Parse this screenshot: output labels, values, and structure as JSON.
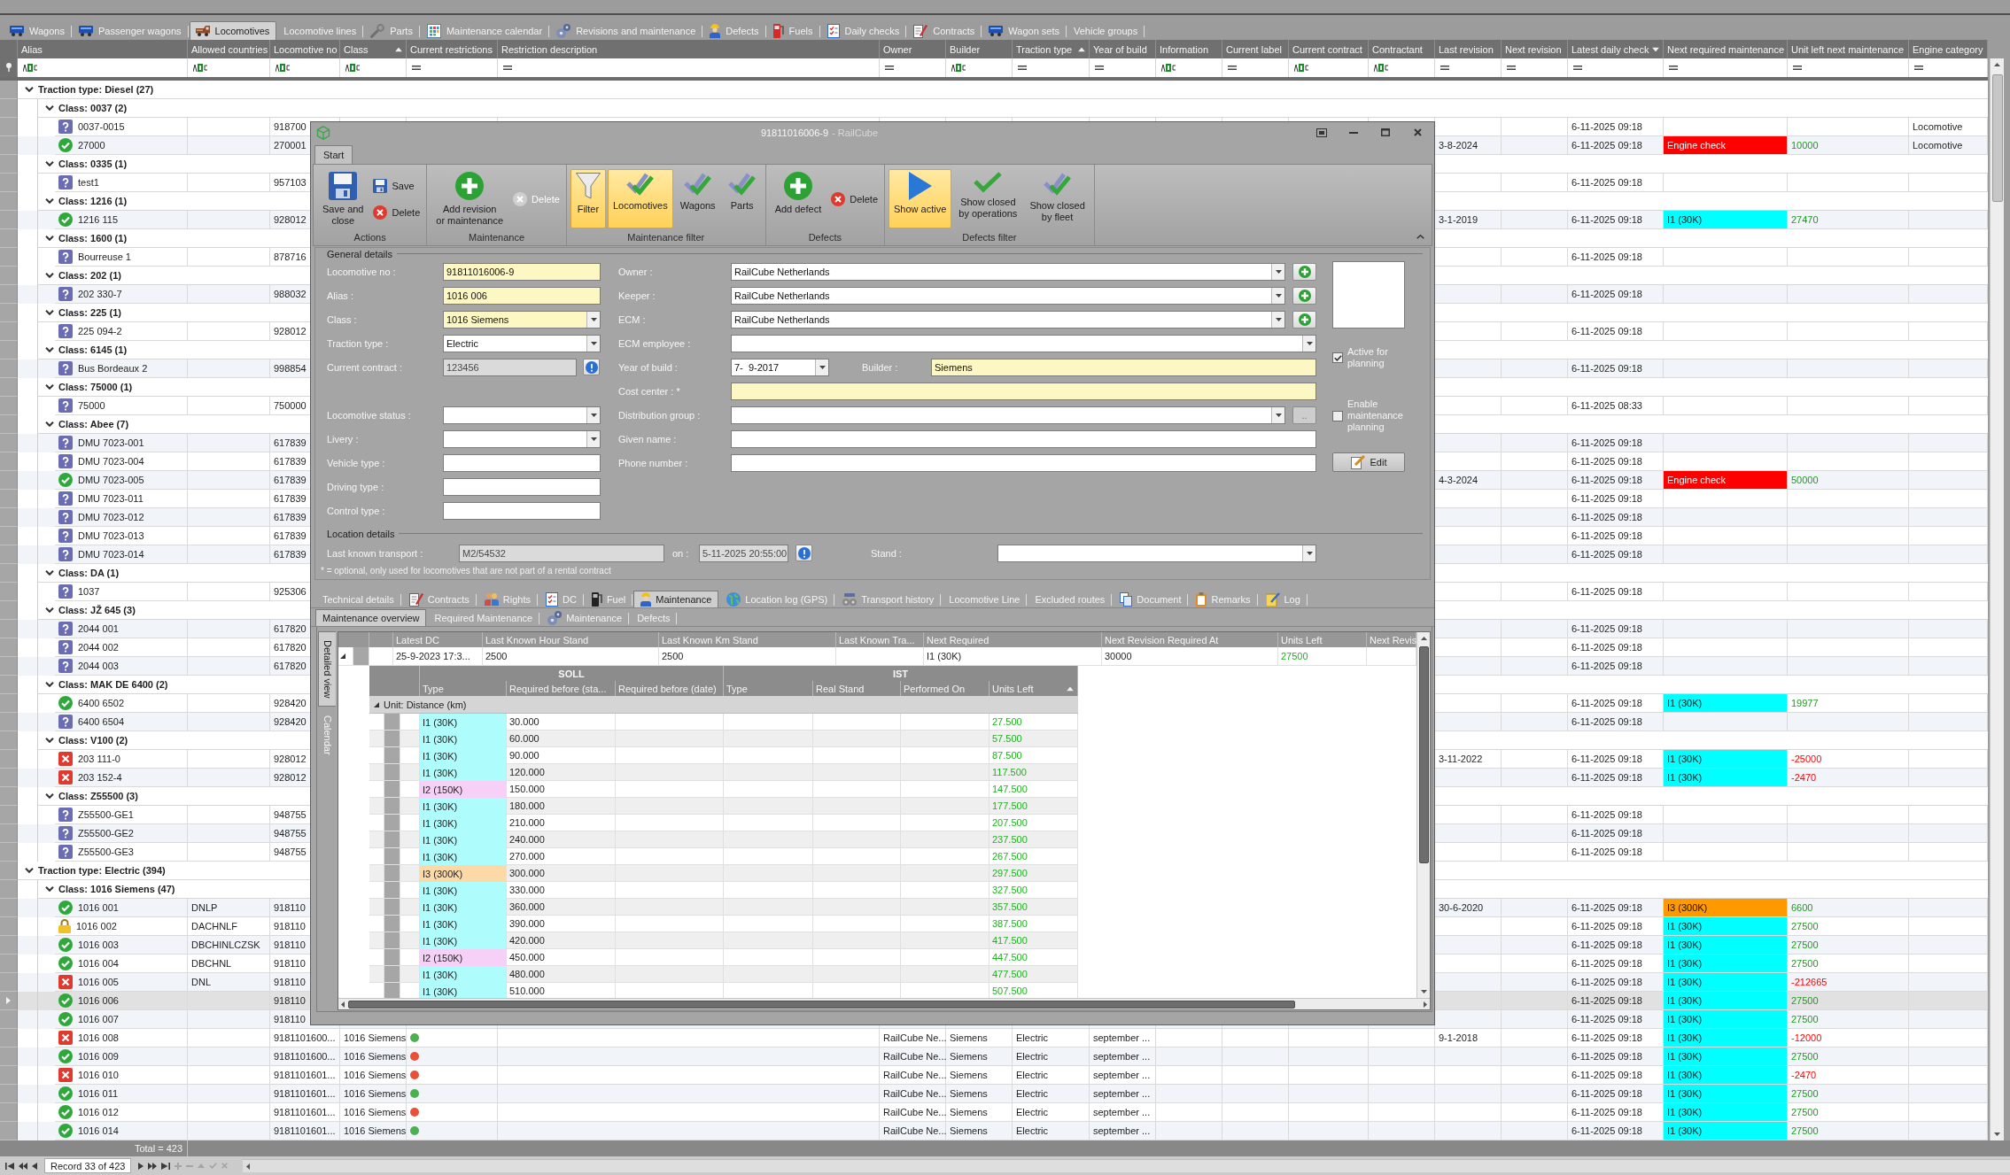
{
  "app_tabs": [
    {
      "label": "Wagons",
      "selected": false
    },
    {
      "label": "Passenger wagons",
      "selected": false
    },
    {
      "label": "Locomotives",
      "selected": true
    },
    {
      "label": "Locomotive lines",
      "selected": false
    },
    {
      "label": "Parts",
      "selected": false
    },
    {
      "label": "Maintenance calendar",
      "selected": false
    },
    {
      "label": "Revisions and maintenance",
      "selected": false
    },
    {
      "label": "Defects",
      "selected": false
    },
    {
      "label": "Fuels",
      "selected": false
    },
    {
      "label": "Daily checks",
      "selected": false
    },
    {
      "label": "Contracts",
      "selected": false
    },
    {
      "label": "Wagon sets",
      "selected": false
    },
    {
      "label": "Vehicle groups",
      "selected": false
    }
  ],
  "grid": {
    "columns": [
      {
        "label": "Alias",
        "sorted": false,
        "kind": "text"
      },
      {
        "label": "Allowed countries",
        "sorted": false,
        "kind": "text"
      },
      {
        "label": "Locomotive no",
        "sorted": false,
        "kind": "text"
      },
      {
        "label": "Class",
        "sorted": true,
        "descending": false,
        "kind": "text"
      },
      {
        "label": "Current restrictions",
        "sorted": false,
        "kind": "equals"
      },
      {
        "label": "Restriction description",
        "sorted": false,
        "kind": "equals"
      },
      {
        "label": "Owner",
        "sorted": false,
        "kind": "equals"
      },
      {
        "label": "Builder",
        "sorted": false,
        "kind": "text"
      },
      {
        "label": "Traction type",
        "sorted": true,
        "descending": false,
        "kind": "equals"
      },
      {
        "label": "Year of build",
        "sorted": false,
        "kind": "equals"
      },
      {
        "label": "Information",
        "sorted": false,
        "kind": "text"
      },
      {
        "label": "Current label",
        "sorted": false,
        "kind": "equals"
      },
      {
        "label": "Current contract",
        "sorted": false,
        "kind": "text"
      },
      {
        "label": "Contractant",
        "sorted": false,
        "kind": "text"
      },
      {
        "label": "Last revision",
        "sorted": false,
        "kind": "equals"
      },
      {
        "label": "Next revision",
        "sorted": false,
        "kind": "equals"
      },
      {
        "label": "Latest daily check",
        "sorted": true,
        "descending": true,
        "kind": "equals"
      },
      {
        "label": "Next required maintenance",
        "sorted": false,
        "kind": "equals"
      },
      {
        "label": "Unit left next maintenance",
        "sorted": false,
        "kind": "equals"
      },
      {
        "label": "Engine category",
        "sorted": false,
        "kind": "equals"
      }
    ],
    "groups": [
      {
        "label": "Traction type: Diesel (27)",
        "expanded": true,
        "children": [
          {
            "label": "Class: 0037 (2)",
            "expanded": true,
            "children": [
              {
                "kind": "unknown",
                "selected": false,
                "alias": "0037-0015",
                "locomotive_no": "918700",
                "latest_daily_check": "6-11-2025 09:18",
                "engine_category": "Locomotive"
              },
              {
                "kind": "ok",
                "selected": false,
                "alias": "27000",
                "locomotive_no": "270001",
                "last_revision": "3-8-2024",
                "latest_daily_check": "6-11-2025 09:18",
                "next_required_maintenance": {
                  "label": "Engine check",
                  "color": "#ff0000"
                },
                "unit_left": {
                  "value": "10000",
                  "overdue": false
                },
                "engine_category": "Locomotive"
              }
            ]
          },
          {
            "label": "Class: 0335 (1)",
            "expanded": true,
            "children": [
              {
                "kind": "unknown",
                "selected": false,
                "alias": "test1",
                "locomotive_no": "957103",
                "latest_daily_check": "6-11-2025 09:18"
              }
            ]
          },
          {
            "label": "Class: 1216 (1)",
            "expanded": true,
            "children": [
              {
                "kind": "ok",
                "selected": false,
                "alias": "1216 115",
                "locomotive_no": "928012",
                "last_revision": "3-1-2019",
                "latest_daily_check": "6-11-2025 09:18",
                "next_required_maintenance": {
                  "label": "I1 (30K)",
                  "color": "#00ffff"
                },
                "unit_left": {
                  "value": "27470",
                  "overdue": false
                }
              }
            ]
          },
          {
            "label": "Class: 1600 (1)",
            "expanded": true,
            "children": [
              {
                "kind": "unknown",
                "selected": false,
                "alias": "Bourreuse 1",
                "locomotive_no": "878716",
                "latest_daily_check": "6-11-2025 09:18"
              }
            ]
          },
          {
            "label": "Class: 202 (1)",
            "expanded": true,
            "children": [
              {
                "kind": "unknown",
                "selected": false,
                "alias": "202 330-7",
                "locomotive_no": "988032",
                "latest_daily_check": "6-11-2025 09:18"
              }
            ]
          },
          {
            "label": "Class: 225 (1)",
            "expanded": true,
            "children": [
              {
                "kind": "unknown",
                "selected": false,
                "alias": "225 094-2",
                "locomotive_no": "928012",
                "latest_daily_check": "6-11-2025 09:18"
              }
            ]
          },
          {
            "label": "Class: 6145 (1)",
            "expanded": true,
            "children": [
              {
                "kind": "unknown",
                "selected": false,
                "alias": "Bus Bordeaux 2",
                "locomotive_no": "998854",
                "latest_daily_check": "6-11-2025 09:18"
              }
            ]
          },
          {
            "label": "Class: 75000 (1)",
            "expanded": true,
            "children": [
              {
                "kind": "unknown",
                "selected": false,
                "alias": "75000",
                "locomotive_no": "750000",
                "latest_daily_check": "6-11-2025 08:33"
              }
            ]
          },
          {
            "label": "Class: Abee (7)",
            "expanded": true,
            "children": [
              {
                "kind": "unknown",
                "selected": false,
                "alias": "DMU 7023-001",
                "locomotive_no": "617839",
                "latest_daily_check": "6-11-2025 09:18"
              },
              {
                "kind": "unknown",
                "selected": false,
                "alias": "DMU 7023-004",
                "locomotive_no": "617839",
                "latest_daily_check": "6-11-2025 09:18"
              },
              {
                "kind": "ok",
                "selected": false,
                "alias": "DMU 7023-005",
                "locomotive_no": "617839",
                "last_revision": "4-3-2024",
                "latest_daily_check": "6-11-2025 09:18",
                "next_required_maintenance": {
                  "label": "Engine check",
                  "color": "#ff0000"
                },
                "unit_left": {
                  "value": "50000",
                  "overdue": false
                }
              },
              {
                "kind": "unknown",
                "selected": false,
                "alias": "DMU 7023-011",
                "locomotive_no": "617839",
                "latest_daily_check": "6-11-2025 09:18"
              },
              {
                "kind": "unknown",
                "selected": false,
                "alias": "DMU 7023-012",
                "locomotive_no": "617839",
                "latest_daily_check": "6-11-2025 09:18"
              },
              {
                "kind": "unknown",
                "selected": false,
                "alias": "DMU 7023-013",
                "locomotive_no": "617839",
                "latest_daily_check": "6-11-2025 09:18"
              },
              {
                "kind": "unknown",
                "selected": false,
                "alias": "DMU 7023-014",
                "locomotive_no": "617839",
                "latest_daily_check": "6-11-2025 09:18"
              }
            ]
          },
          {
            "label": "Class: DA (1)",
            "expanded": true,
            "children": [
              {
                "kind": "unknown",
                "selected": false,
                "alias": "1037",
                "locomotive_no": "925306",
                "latest_daily_check": "6-11-2025 09:18"
              }
            ]
          },
          {
            "label": "Class: JŽ 645 (3)",
            "expanded": true,
            "children": [
              {
                "kind": "unknown",
                "selected": false,
                "alias": "2044 001",
                "locomotive_no": "617820",
                "latest_daily_check": "6-11-2025 09:18"
              },
              {
                "kind": "unknown",
                "selected": false,
                "alias": "2044 002",
                "locomotive_no": "617820",
                "latest_daily_check": "6-11-2025 09:18"
              },
              {
                "kind": "unknown",
                "selected": false,
                "alias": "2044 003",
                "locomotive_no": "617820",
                "latest_daily_check": "6-11-2025 09:18"
              }
            ]
          },
          {
            "label": "Class: MAK DE 6400 (2)",
            "expanded": true,
            "children": [
              {
                "kind": "ok",
                "selected": false,
                "alias": "6400 6502",
                "locomotive_no": "928420",
                "latest_daily_check": "6-11-2025 09:18",
                "next_required_maintenance": {
                  "label": "I1 (30K)",
                  "color": "#00ffff"
                },
                "unit_left": {
                  "value": "19977",
                  "overdue": false
                }
              },
              {
                "kind": "unknown",
                "selected": false,
                "alias": "6400 6504",
                "locomotive_no": "928420",
                "latest_daily_check": "6-11-2025 09:18"
              }
            ]
          },
          {
            "label": "Class: V100 (2)",
            "expanded": true,
            "children": [
              {
                "kind": "error",
                "selected": false,
                "alias": "203 111-0",
                "locomotive_no": "928012",
                "last_revision": "3-11-2022",
                "latest_daily_check": "6-11-2025 09:18",
                "next_required_maintenance": {
                  "label": "I1 (30K)",
                  "color": "#00ffff"
                },
                "unit_left": {
                  "value": "-25000",
                  "overdue": true
                }
              },
              {
                "kind": "error",
                "selected": false,
                "alias": "203 152-4",
                "locomotive_no": "928012",
                "latest_daily_check": "6-11-2025 09:18",
                "next_required_maintenance": {
                  "label": "I1 (30K)",
                  "color": "#00ffff"
                },
                "unit_left": {
                  "value": "-2470",
                  "overdue": true
                }
              }
            ]
          },
          {
            "label": "Class: Z55500 (3)",
            "expanded": true,
            "children": [
              {
                "kind": "unknown",
                "selected": false,
                "alias": "Z55500-GE1",
                "locomotive_no": "948755",
                "latest_daily_check": "6-11-2025 09:18"
              },
              {
                "kind": "unknown",
                "selected": false,
                "alias": "Z55500-GE2",
                "locomotive_no": "948755",
                "latest_daily_check": "6-11-2025 09:18"
              },
              {
                "kind": "unknown",
                "selected": false,
                "alias": "Z55500-GE3",
                "locomotive_no": "948755",
                "latest_daily_check": "6-11-2025 09:18"
              }
            ]
          }
        ]
      },
      {
        "label": "Traction type: Electric (394)",
        "expanded": true,
        "children": [
          {
            "label": "Class: 1016 Siemens (47)",
            "expanded": true,
            "children": [
              {
                "kind": "ok",
                "selected": false,
                "alias": "1016 001",
                "allowed_countries": "DNLP",
                "locomotive_no": "918110",
                "last_revision": "30-6-2020",
                "latest_daily_check": "6-11-2025 09:18",
                "next_required_maintenance": {
                  "label": "I3 (300K)",
                  "color": "#ff9900"
                },
                "unit_left": {
                  "value": "6600",
                  "overdue": false
                }
              },
              {
                "kind": "locked",
                "selected": false,
                "alias": "1016 002",
                "allowed_countries": "DACHNLF",
                "locomotive_no": "918110",
                "latest_daily_check": "6-11-2025 09:18",
                "next_required_maintenance": {
                  "label": "I1 (30K)",
                  "color": "#00ffff"
                },
                "unit_left": {
                  "value": "27500",
                  "overdue": false
                }
              },
              {
                "kind": "ok",
                "selected": false,
                "alias": "1016 003",
                "allowed_countries": "DBCHINLCZSK",
                "locomotive_no": "918110",
                "latest_daily_check": "6-11-2025 09:18",
                "next_required_maintenance": {
                  "label": "I1 (30K)",
                  "color": "#00ffff"
                },
                "unit_left": {
                  "value": "27500",
                  "overdue": false
                }
              },
              {
                "kind": "ok",
                "selected": false,
                "alias": "1016 004",
                "allowed_countries": "DBCHNL",
                "locomotive_no": "918110",
                "latest_daily_check": "6-11-2025 09:18",
                "next_required_maintenance": {
                  "label": "I1 (30K)",
                  "color": "#00ffff"
                },
                "unit_left": {
                  "value": "27500",
                  "overdue": false
                }
              },
              {
                "kind": "error",
                "selected": false,
                "alias": "1016 005",
                "allowed_countries": "DNL",
                "locomotive_no": "918110",
                "latest_daily_check": "6-11-2025 09:18",
                "next_required_maintenance": {
                  "label": "I1 (30K)",
                  "color": "#00ffff"
                },
                "unit_left": {
                  "value": "-212665",
                  "overdue": true
                }
              },
              {
                "kind": "ok",
                "selected": true,
                "alias": "1016 006",
                "locomotive_no": "918110",
                "latest_daily_check": "6-11-2025 09:18",
                "next_required_maintenance": {
                  "label": "I1 (30K)",
                  "color": "#00ffff"
                },
                "unit_left": {
                  "value": "27500",
                  "overdue": false
                }
              },
              {
                "kind": "ok",
                "selected": false,
                "alias": "1016 007",
                "locomotive_no": "918110",
                "latest_daily_check": "6-11-2025 09:18",
                "next_required_maintenance": {
                  "label": "I1 (30K)",
                  "color": "#00ffff"
                },
                "unit_left": {
                  "value": "27500",
                  "overdue": false
                }
              },
              {
                "kind": "error",
                "selected": false,
                "alias": "1016 008",
                "locomotive_no": "9181101600...",
                "class": "1016 Siemens",
                "current_restrictions": {
                  "color": "#4cb050"
                },
                "owner": "RailCube Ne...",
                "builder": "Siemens",
                "traction_type": "Electric",
                "year_of_build": "september ...",
                "last_revision": "9-1-2018",
                "latest_daily_check": "6-11-2025 09:18",
                "next_required_maintenance": {
                  "label": "I1 (30K)",
                  "color": "#00ffff"
                },
                "unit_left": {
                  "value": "-12000",
                  "overdue": true
                }
              },
              {
                "kind": "ok",
                "selected": false,
                "alias": "1016 009",
                "locomotive_no": "9181101600...",
                "class": "1016 Siemens",
                "current_restrictions": {
                  "color": "#e8503a"
                },
                "owner": "RailCube Ne...",
                "builder": "Siemens",
                "traction_type": "Electric",
                "year_of_build": "september ...",
                "latest_daily_check": "6-11-2025 09:18",
                "next_required_maintenance": {
                  "label": "I1 (30K)",
                  "color": "#00ffff"
                },
                "unit_left": {
                  "value": "27500",
                  "overdue": false
                }
              },
              {
                "kind": "error",
                "selected": false,
                "alias": "1016 010",
                "locomotive_no": "9181101601...",
                "class": "1016 Siemens",
                "current_restrictions": {
                  "color": "#e8503a"
                },
                "owner": "RailCube Ne...",
                "builder": "Siemens",
                "traction_type": "Electric",
                "year_of_build": "september ...",
                "latest_daily_check": "6-11-2025 09:18",
                "next_required_maintenance": {
                  "label": "I1 (30K)",
                  "color": "#00ffff"
                },
                "unit_left": {
                  "value": "-2470",
                  "overdue": true
                }
              },
              {
                "kind": "ok",
                "selected": false,
                "alias": "1016 011",
                "locomotive_no": "9181101601...",
                "class": "1016 Siemens",
                "current_restrictions": {
                  "color": "#4cb050"
                },
                "owner": "RailCube Ne...",
                "builder": "Siemens",
                "traction_type": "Electric",
                "year_of_build": "september ...",
                "latest_daily_check": "6-11-2025 09:18",
                "next_required_maintenance": {
                  "label": "I1 (30K)",
                  "color": "#00ffff"
                },
                "unit_left": {
                  "value": "27500",
                  "overdue": false
                }
              },
              {
                "kind": "ok",
                "selected": false,
                "alias": "1016 012",
                "locomotive_no": "9181101601...",
                "class": "1016 Siemens",
                "current_restrictions": {
                  "color": "#e8503a"
                },
                "owner": "RailCube Ne...",
                "builder": "Siemens",
                "traction_type": "Electric",
                "year_of_build": "september ...",
                "latest_daily_check": "6-11-2025 09:18",
                "next_required_maintenance": {
                  "label": "I1 (30K)",
                  "color": "#00ffff"
                },
                "unit_left": {
                  "value": "27500",
                  "overdue": false
                }
              },
              {
                "kind": "ok",
                "selected": false,
                "alias": "1016 014",
                "locomotive_no": "9181101601...",
                "class": "1016 Siemens",
                "current_restrictions": {
                  "color": "#4cb050"
                },
                "owner": "RailCube Ne...",
                "builder": "Siemens",
                "traction_type": "Electric",
                "year_of_build": "september ...",
                "latest_daily_check": "6-11-2025 09:18",
                "next_required_maintenance": {
                  "label": "I1 (30K)",
                  "color": "#00ffff"
                },
                "unit_left": {
                  "value": "27500",
                  "overdue": false
                }
              }
            ]
          }
        ]
      }
    ],
    "total": "Total = 423"
  },
  "navigator": {
    "record": "Record 33 of 423",
    "buttons": [
      {
        "kind": "first",
        "disabled": false
      },
      {
        "kind": "prev_page",
        "disabled": false
      },
      {
        "kind": "prev",
        "disabled": false
      },
      {
        "kind": "next",
        "disabled": false
      },
      {
        "kind": "next_page",
        "disabled": false
      },
      {
        "kind": "last",
        "disabled": false
      },
      {
        "kind": "append",
        "disabled": true
      },
      {
        "kind": "remove",
        "disabled": true
      },
      {
        "kind": "edit",
        "disabled": true
      },
      {
        "kind": "end_edit",
        "disabled": true
      },
      {
        "kind": "cancel_edit",
        "disabled": true
      }
    ]
  },
  "dialog": {
    "title": "91811016006-9",
    "app_name": "- RailCube",
    "ribbon": {
      "tabs": [
        {
          "label": "Start",
          "selected": true
        }
      ],
      "groups": [
        {
          "label": "Actions",
          "buttons": [
            {
              "kind": "large",
              "label": "Save and\nclose",
              "disabled": false
            },
            {
              "kind": "small",
              "label": "Save",
              "disabled": false
            },
            {
              "kind": "small",
              "label": "Delete",
              "disabled": false
            }
          ]
        },
        {
          "label": "Maintenance",
          "buttons": [
            {
              "kind": "large",
              "label": "Add revision\nor maintenance",
              "disabled": false
            },
            {
              "kind": "small",
              "label": "Delete",
              "disabled": true
            }
          ]
        },
        {
          "label": "Maintenance filter",
          "buttons": [
            {
              "kind": "large",
              "label": "Filter",
              "pressed": true,
              "disabled": false
            },
            {
              "kind": "large",
              "label": "Locomotives",
              "pressed": true,
              "disabled": false
            },
            {
              "kind": "large",
              "label": "Wagons",
              "pressed": false,
              "disabled": false
            },
            {
              "kind": "large",
              "label": "Parts",
              "pressed": false,
              "disabled": false
            }
          ]
        },
        {
          "label": "Defects",
          "buttons": [
            {
              "kind": "large",
              "label": "Add defect",
              "disabled": false
            },
            {
              "kind": "small",
              "label": "Delete",
              "disabled": false
            }
          ]
        },
        {
          "label": "Defects filter",
          "buttons": [
            {
              "kind": "large",
              "label": "Show active",
              "pressed": true,
              "disabled": false
            },
            {
              "kind": "large",
              "label": "Show closed\nby operations",
              "pressed": false,
              "disabled": false
            },
            {
              "kind": "large",
              "label": "Show closed\nby fleet",
              "pressed": false,
              "disabled": false
            }
          ]
        }
      ]
    },
    "general": {
      "title": "General details",
      "left_groups": [
        [
          {
            "label": "Locomotive no :",
            "kind": "text",
            "value": "91811016006-9",
            "required": true,
            "disabled": false
          },
          {
            "label": "Alias :",
            "kind": "text",
            "value": "1016 006",
            "required": true,
            "disabled": false
          },
          {
            "label": "Class :",
            "kind": "dropdown",
            "value": "1016 Siemens",
            "required": true,
            "disabled": false
          },
          {
            "label": "Traction type :",
            "kind": "dropdown",
            "value": "Electric",
            "required": false,
            "disabled": false
          },
          {
            "label": "Current contract :",
            "kind": "text",
            "value": "123456",
            "required": false,
            "disabled": true,
            "button": {
              "kind": "info",
              "disabled": false
            }
          }
        ],
        [
          {
            "label": "Locomotive status :",
            "kind": "dropdown",
            "required": false,
            "disabled": false
          },
          {
            "label": "Livery :",
            "kind": "dropdown",
            "required": false,
            "disabled": false
          },
          {
            "label": "Vehicle type :",
            "kind": "text",
            "required": false,
            "disabled": false
          },
          {
            "label": "Driving type :",
            "kind": "text",
            "required": false,
            "disabled": false
          },
          {
            "label": "Control type :",
            "kind": "text",
            "required": false,
            "disabled": false
          }
        ]
      ],
      "middle": [
        {
          "label": "Owner :",
          "kind": "dropdown",
          "value": "RailCube Netherlands",
          "required": false,
          "disabled": false,
          "button": {
            "kind": "add",
            "disabled": false
          }
        },
        {
          "label": "Keeper :",
          "kind": "dropdown",
          "value": "RailCube Netherlands",
          "required": false,
          "disabled": false,
          "button": {
            "kind": "add",
            "disabled": false
          }
        },
        {
          "label": "ECM :",
          "kind": "dropdown",
          "value": "RailCube Netherlands",
          "required": false,
          "disabled": false,
          "button": {
            "kind": "add",
            "disabled": false
          }
        },
        {
          "label": "ECM employee :",
          "kind": "dropdown",
          "required": false,
          "disabled": false
        },
        {
          "label": "Year of build :",
          "kind": "date",
          "value": "7-  9-2017",
          "required": false,
          "disabled": false,
          "pair": {
            "label": "Builder :",
            "kind": "text",
            "value": "Siemens",
            "required": true,
            "disabled": false
          }
        },
        {
          "label": "Cost center : *",
          "kind": "text",
          "required": true,
          "disabled": false
        },
        {
          "label": "Distribution group :",
          "kind": "dropdown",
          "required": false,
          "disabled": false,
          "button": {
            "kind": "more",
            "label": "..",
            "disabled": true
          }
        },
        {
          "label": "Given name :",
          "kind": "text",
          "required": false,
          "disabled": false
        },
        {
          "label": "Phone number :",
          "kind": "text",
          "required": false,
          "disabled": false
        }
      ],
      "checkboxes": [
        {
          "label": "Active for\nplanning",
          "checked": true
        },
        {
          "label": "Enable\nmaintenance\nplanning",
          "checked": false
        }
      ],
      "edit_button": "Edit"
    },
    "location": {
      "title": "Location details",
      "fields": [
        {
          "label": "Last known transport :",
          "kind": "text",
          "value": "M2/54532",
          "disabled": true
        },
        {
          "label": "on :",
          "kind": "text",
          "value": "5-11-2025 20:55:00",
          "disabled": true,
          "button": {
            "kind": "info",
            "disabled": false
          }
        },
        {
          "label": "Stand :",
          "kind": "dropdown",
          "disabled": false
        }
      ],
      "note": "* = optional, only used for locomotives that are not part of a rental contract"
    },
    "tabs": [
      {
        "label": "Technical details",
        "selected": false
      },
      {
        "label": "Contracts",
        "selected": false
      },
      {
        "label": "Rights",
        "selected": false
      },
      {
        "label": "DC",
        "selected": false
      },
      {
        "label": "Fuel",
        "selected": false
      },
      {
        "label": "Maintenance",
        "selected": true
      },
      {
        "label": "Location log (GPS)",
        "selected": false
      },
      {
        "label": "Transport history",
        "selected": false
      },
      {
        "label": "Locomotive Line",
        "selected": false
      },
      {
        "label": "Excluded routes",
        "selected": false
      },
      {
        "label": "Document",
        "selected": false
      },
      {
        "label": "Remarks",
        "selected": false
      },
      {
        "label": "Log",
        "selected": false
      }
    ],
    "subtabs": [
      {
        "label": "Maintenance overview",
        "selected": true
      },
      {
        "label": "Required Maintenance",
        "selected": false
      },
      {
        "label": "Maintenance",
        "selected": false
      },
      {
        "label": "Defects",
        "selected": false
      }
    ],
    "side_tabs": [
      {
        "label": "Detailed view",
        "selected": true
      },
      {
        "label": "Calendar",
        "selected": false
      }
    ],
    "overview": {
      "columns": [
        "Latest DC",
        "Last Known Hour Stand",
        "Last Known Km Stand",
        "Last Known Tra...",
        "Next Required",
        "Next Revision Required At",
        "Units Left",
        "Next Revis"
      ],
      "rows": [
        {
          "expanded": true,
          "latest_dc": "25-9-2023 17:3...",
          "hour_stand": "2500",
          "km_stand": "2500",
          "next_required": "I1 (30K)",
          "next_revision_at": "30000",
          "units_left": "27500"
        }
      ]
    },
    "plan": {
      "bands": [
        "SOLL",
        "IST"
      ],
      "columns": [
        {
          "label": "Type",
          "sorted": false
        },
        {
          "label": "Required before (sta...",
          "sorted": false
        },
        {
          "label": "Required before (date)",
          "sorted": false
        },
        {
          "label": "Type",
          "sorted": false
        },
        {
          "label": "Real Stand",
          "sorted": false
        },
        {
          "label": "Performed On",
          "sorted": false
        },
        {
          "label": "Units Left",
          "sorted": true,
          "descending": false
        }
      ],
      "group": {
        "label": "Unit: Distance (km)",
        "expanded": true
      },
      "rows": [
        {
          "type": "I1 (30K)",
          "color": "#aefcfc",
          "required_before": "30.000",
          "units_left": "27.500"
        },
        {
          "type": "I1 (30K)",
          "color": "#aefcfc",
          "required_before": "60.000",
          "units_left": "57.500"
        },
        {
          "type": "I1 (30K)",
          "color": "#aefcfc",
          "required_before": "90.000",
          "units_left": "87.500"
        },
        {
          "type": "I1 (30K)",
          "color": "#aefcfc",
          "required_before": "120.000",
          "units_left": "117.500"
        },
        {
          "type": "I2 (150K)",
          "color": "#f6d0f6",
          "required_before": "150.000",
          "units_left": "147.500"
        },
        {
          "type": "I1 (30K)",
          "color": "#aefcfc",
          "required_before": "180.000",
          "units_left": "177.500"
        },
        {
          "type": "I1 (30K)",
          "color": "#aefcfc",
          "required_before": "210.000",
          "units_left": "207.500"
        },
        {
          "type": "I1 (30K)",
          "color": "#aefcfc",
          "required_before": "240.000",
          "units_left": "237.500"
        },
        {
          "type": "I1 (30K)",
          "color": "#aefcfc",
          "required_before": "270.000",
          "units_left": "267.500"
        },
        {
          "type": "I3 (300K)",
          "color": "#fdd9a8",
          "required_before": "300.000",
          "units_left": "297.500"
        },
        {
          "type": "I1 (30K)",
          "color": "#aefcfc",
          "required_before": "330.000",
          "units_left": "327.500"
        },
        {
          "type": "I1 (30K)",
          "color": "#aefcfc",
          "required_before": "360.000",
          "units_left": "357.500"
        },
        {
          "type": "I1 (30K)",
          "color": "#aefcfc",
          "required_before": "390.000",
          "units_left": "387.500"
        },
        {
          "type": "I1 (30K)",
          "color": "#aefcfc",
          "required_before": "420.000",
          "units_left": "417.500"
        },
        {
          "type": "I2 (150K)",
          "color": "#f6d0f6",
          "required_before": "450.000",
          "units_left": "447.500"
        },
        {
          "type": "I1 (30K)",
          "color": "#aefcfc",
          "required_before": "480.000",
          "units_left": "477.500"
        },
        {
          "type": "I1 (30K)",
          "color": "#aefcfc",
          "required_before": "510.000",
          "units_left": "507.500"
        }
      ]
    }
  }
}
